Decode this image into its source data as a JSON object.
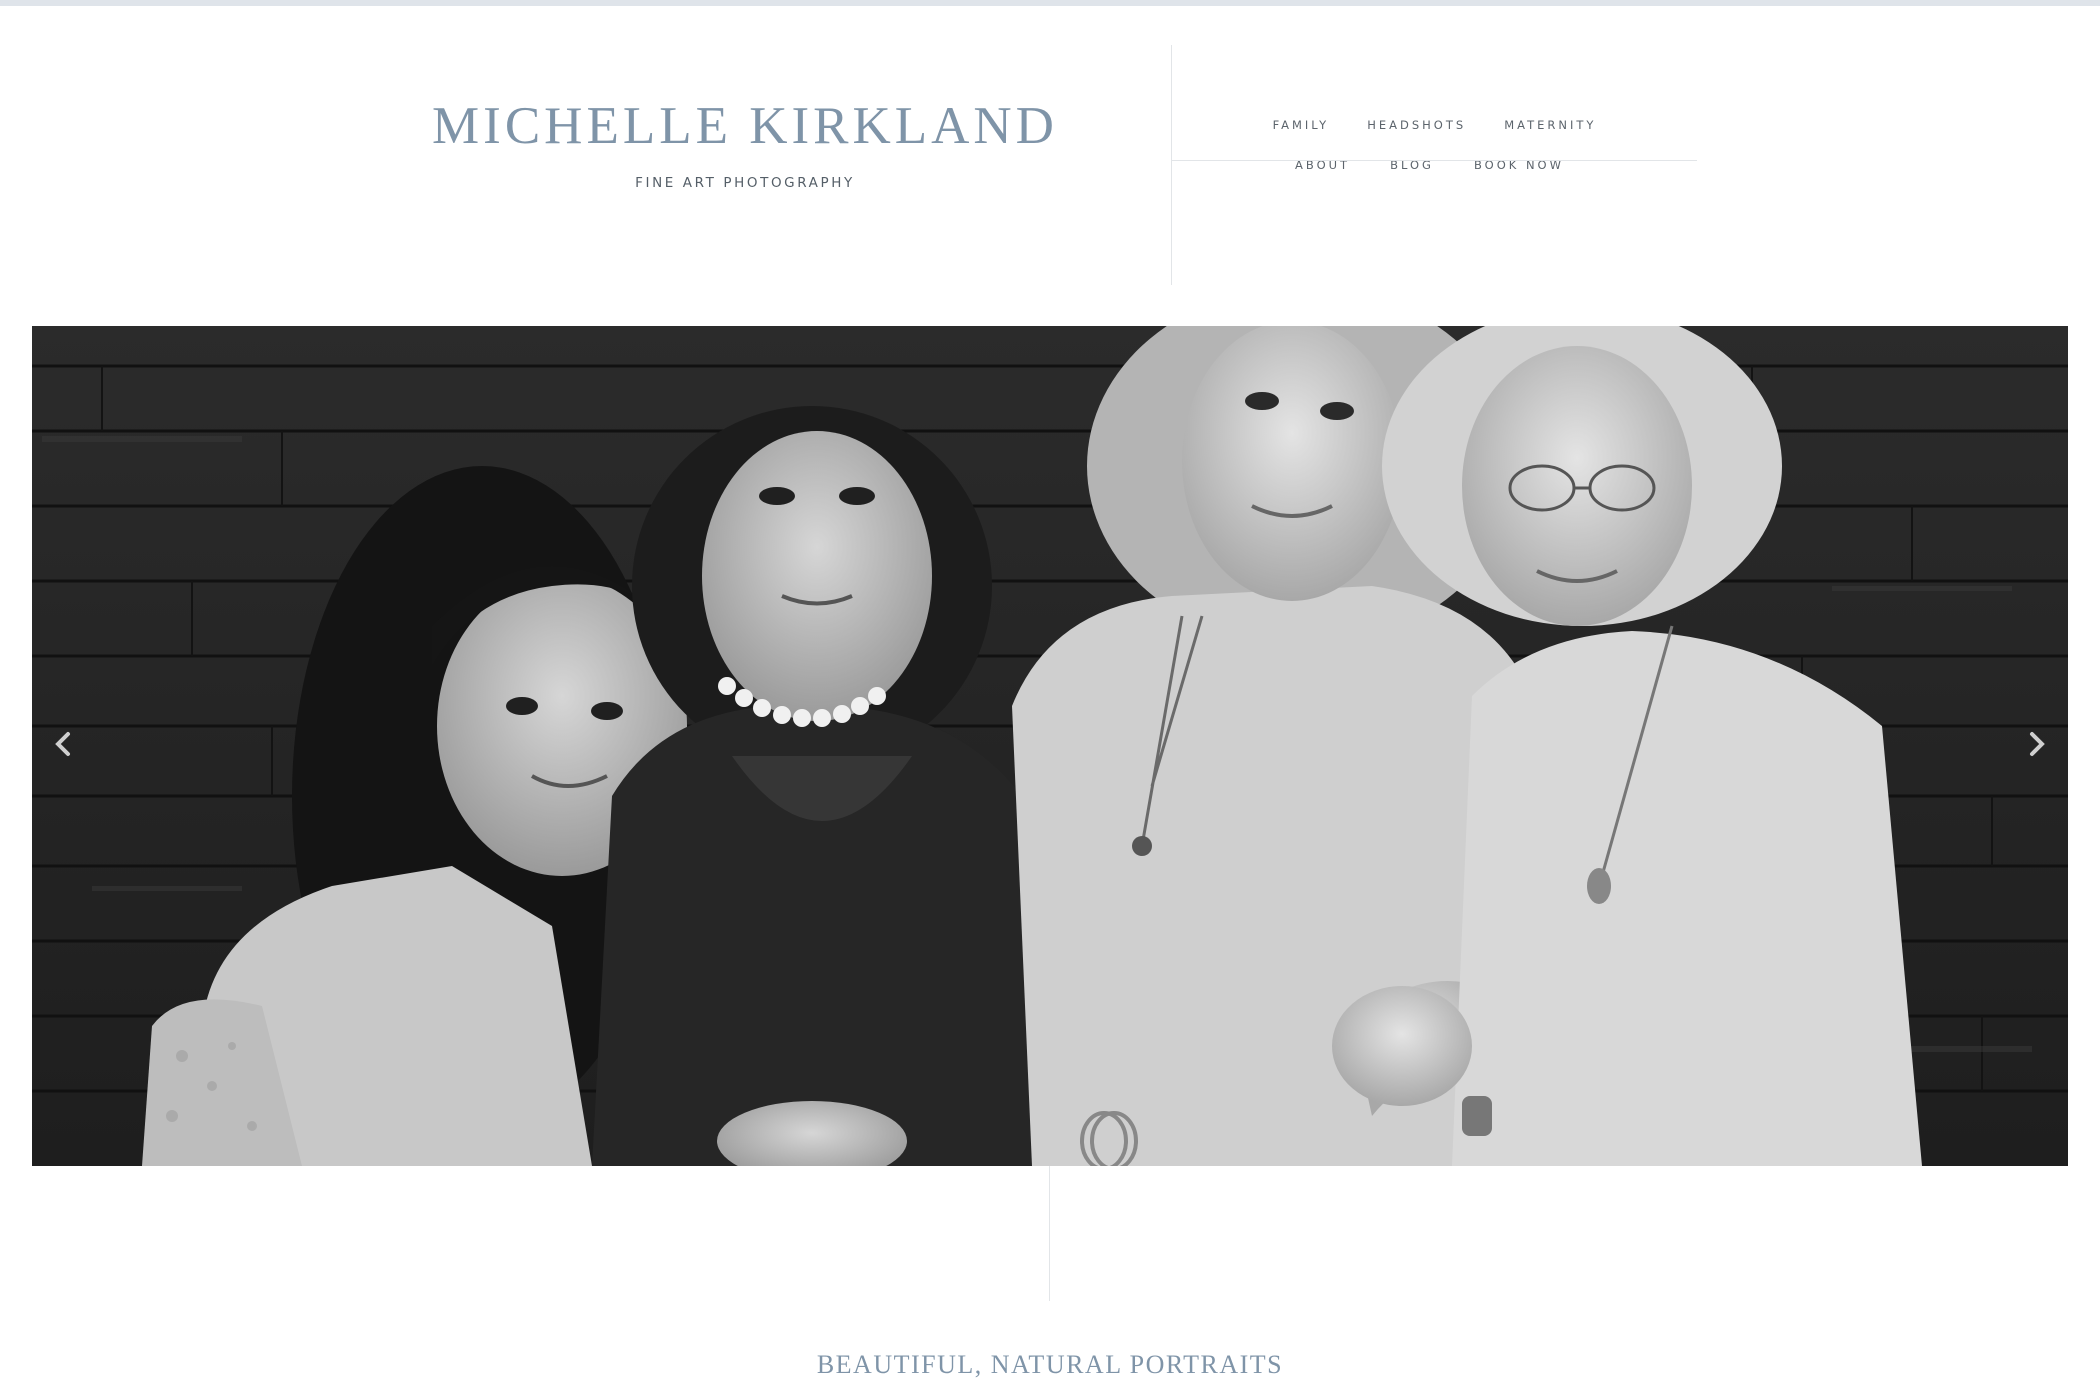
{
  "brand": {
    "title": "MICHELLE KIRKLAND",
    "subtitle": "FINE ART PHOTOGRAPHY"
  },
  "nav": {
    "top_row": [
      "FAMILY",
      "HEADSHOTS",
      "MATERNITY"
    ],
    "bottom_row": [
      "ABOUT",
      "BLOG",
      "BOOK NOW"
    ]
  },
  "slider": {
    "prev_icon": "chevron-left-icon",
    "next_icon": "chevron-right-icon"
  },
  "tagline": "BEAUTIFUL, NATURAL PORTRAITS",
  "colors": {
    "brand": "#7f94a8",
    "nav_text": "#5c646c",
    "divider": "#e2e5e8"
  }
}
